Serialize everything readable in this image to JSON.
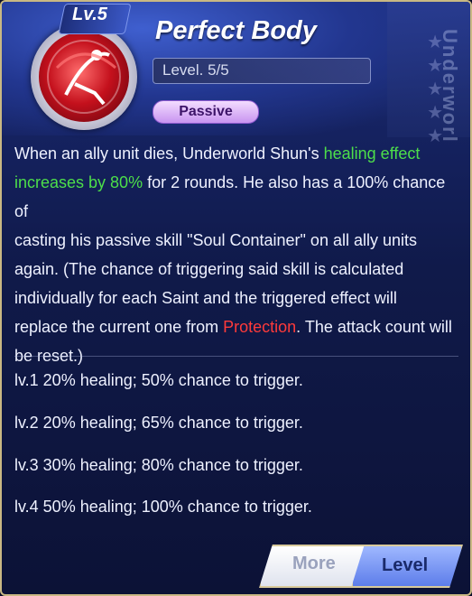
{
  "skill": {
    "level_badge": "Lv.5",
    "title": "Perfect Body",
    "level": "Level. 5/5",
    "tag": "Passive"
  },
  "side_text": "Underworl",
  "description": {
    "line1_a": "When an ally unit dies, Underworld Shun's ",
    "line1_b": "healing effect",
    "line2_a": "increases by 80%",
    "line2_b": " for 2 rounds. He also has a 100% chance of",
    "line3": "casting his passive skill \"Soul Container\" on all ally units",
    "line4": "again. (The chance of triggering said skill is calculated",
    "line5": "individually for each Saint and the triggered effect will",
    "line6_a": "replace the current one from ",
    "line6_b": "Protection",
    "line6_c": ". The attack count will",
    "line7": "be reset.)"
  },
  "levels": [
    "lv.1 20% healing; 50% chance to trigger.",
    "lv.2 20% healing; 65% chance to trigger.",
    "lv.3 30% healing; 80% chance to trigger.",
    "lv.4 50% healing; 100% chance to trigger."
  ],
  "buttons": {
    "more": "More",
    "level": "Level"
  },
  "colors": {
    "highlight_green": "#4ddf4a",
    "highlight_red": "#ff3a3a",
    "tag_purple": "#c894f0"
  }
}
